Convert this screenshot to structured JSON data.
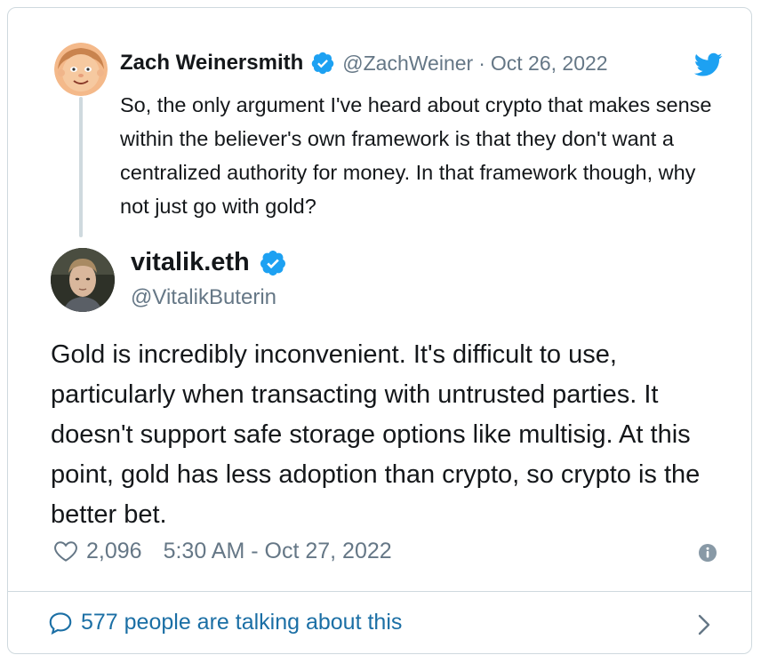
{
  "parent_tweet": {
    "author_name": "Zach Weinersmith",
    "handle": "@ZachWeiner",
    "separator": "·",
    "date": "Oct 26, 2022",
    "text": "So, the only argument I've heard about crypto that makes sense within the believer's own framework is that they don't want a centralized authority for money. In that framework though, why not just go with gold?"
  },
  "main_tweet": {
    "author_name": "vitalik.eth",
    "handle": "@VitalikButerin",
    "text": "Gold is incredibly inconvenient. It's difficult to use, particularly when transacting with untrusted parties. It doesn't support safe storage options like multisig. At this point, gold has less adoption than crypto, so crypto is the better bet.",
    "likes": "2,096",
    "timestamp": "5:30 AM - Oct 27, 2022"
  },
  "footer": {
    "talking_text": "577 people are talking about this"
  },
  "icons": {
    "verified": "verified-badge-icon",
    "twitter": "twitter-bird-icon",
    "like": "heart-icon",
    "info": "info-icon",
    "conversation": "speech-bubble-icon",
    "open": "chevron-right-icon"
  },
  "colors": {
    "accent": "#1da1f2",
    "link": "#1b6fa5",
    "muted": "#657786",
    "border": "#cfd9de"
  }
}
